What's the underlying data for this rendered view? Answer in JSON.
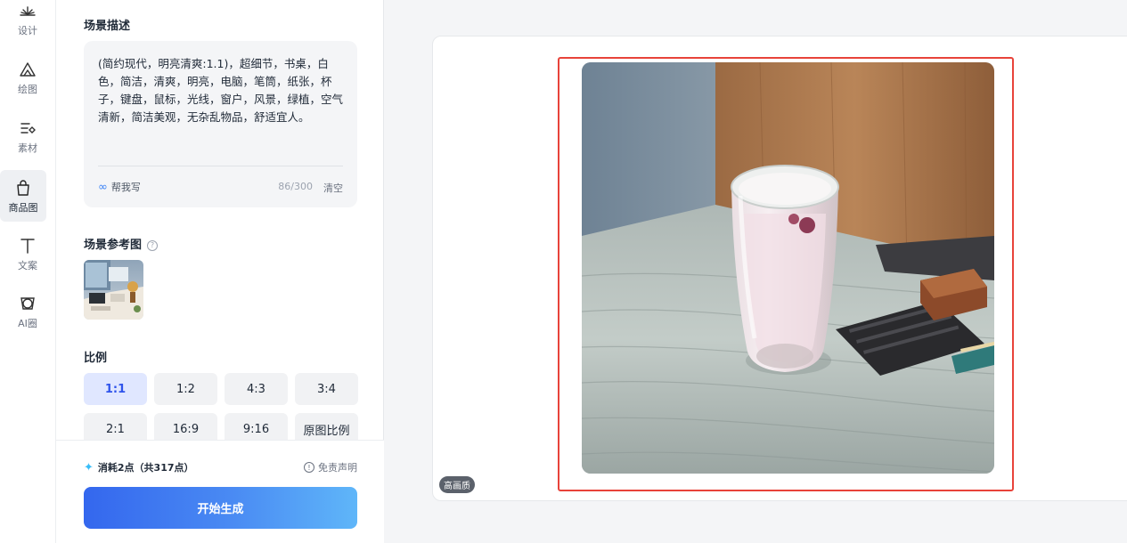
{
  "nav": {
    "items": [
      {
        "label": "设计",
        "icon": "design-icon"
      },
      {
        "label": "绘图",
        "icon": "draw-icon"
      },
      {
        "label": "素材",
        "icon": "assets-icon"
      },
      {
        "label": "商品图",
        "icon": "shopping-bag-icon"
      },
      {
        "label": "文案",
        "icon": "text-icon"
      },
      {
        "label": "AI圈",
        "icon": "ai-circle-icon"
      }
    ],
    "active": "商品图"
  },
  "scene": {
    "title": "场景描述",
    "description": "(简约现代，明亮清爽:1.1)，超细节，书桌，白色，简洁，清爽，明亮，电脑，笔筒，纸张，杯子，键盘，鼠标，光线，窗户，风景，绿植，空气清新，简洁美观，无杂乱物品，舒适宜人。",
    "help_label": "帮我写",
    "count": "86/300",
    "clear_label": "清空"
  },
  "reference": {
    "title": "场景参考图",
    "help_icon": "question-icon"
  },
  "ratio": {
    "title": "比例",
    "options": [
      "1:1",
      "1:2",
      "4:3",
      "3:4",
      "2:1",
      "16:9",
      "9:16",
      "原图比例"
    ],
    "selected": "1:1"
  },
  "footer": {
    "cost": "消耗2点（共317点）",
    "disclaimer": "免责声明",
    "generate_label": "开始生成"
  },
  "preview": {
    "quality_badge": "高画质"
  },
  "colors": {
    "accent": "#2f54eb",
    "highlight_border": "#e8433a",
    "button_gradient_start": "#3467ee",
    "button_gradient_end": "#5fb6f9"
  }
}
